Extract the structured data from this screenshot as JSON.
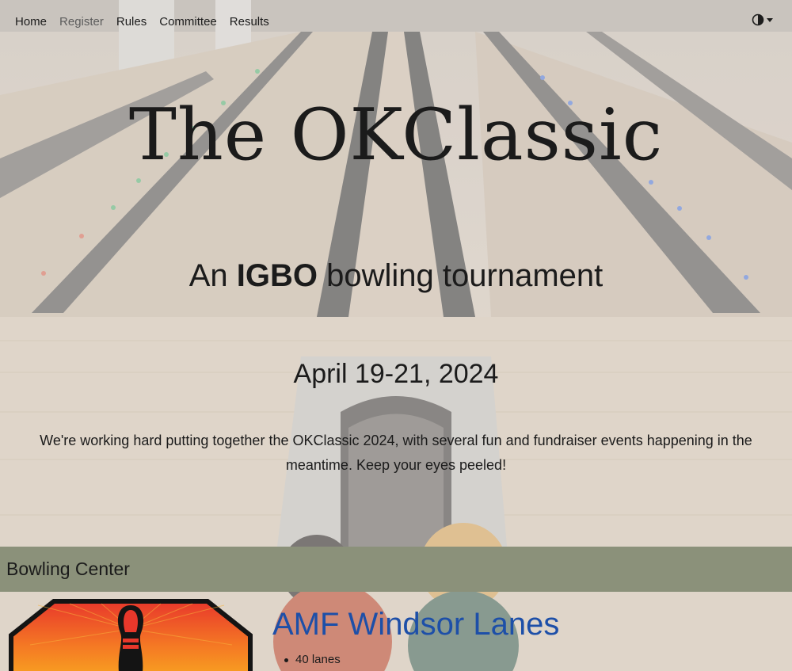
{
  "nav": {
    "items": [
      {
        "label": "Home",
        "active": false
      },
      {
        "label": "Register",
        "active": true
      },
      {
        "label": "Rules",
        "active": false
      },
      {
        "label": "Committee",
        "active": false
      },
      {
        "label": "Results",
        "active": false
      }
    ],
    "theme_toggle_icon": "half-circle-contrast-icon"
  },
  "hero": {
    "title": "The OKClassic",
    "subtitle_prefix": "An ",
    "subtitle_bold": "IGBO",
    "subtitle_suffix": " bowling tournament",
    "date": "April 19-21, 2024",
    "blurb": "We're working hard putting together the OKClassic 2024, with several fun and fundraiser events happening in the meantime. Keep your eyes peeled!"
  },
  "section": {
    "title": "Bowling Center"
  },
  "bowling_center": {
    "name": "AMF Windsor Lanes",
    "features": [
      "40 lanes"
    ],
    "logo_icon": "bowling-pin-logo-icon"
  },
  "colors": {
    "section_bar": "#8b917a",
    "link": "#1d4fa8"
  }
}
